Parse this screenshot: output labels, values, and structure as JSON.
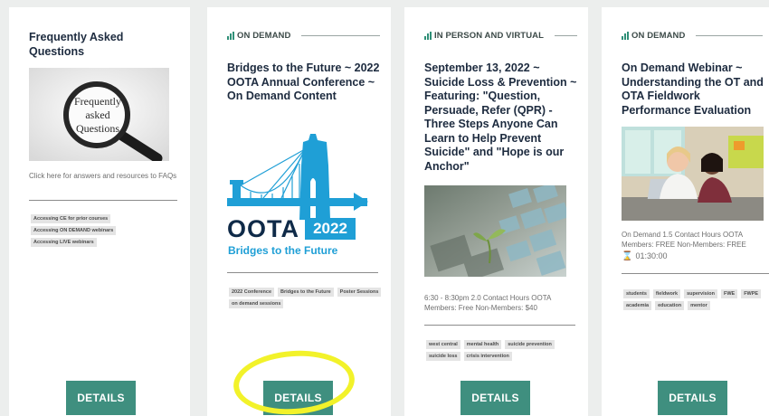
{
  "cards": [
    {
      "title": "Frequently Asked Questions",
      "image_text": "Frequently asked Questions",
      "meta": "Click here for answers and resources to FAQs",
      "tags": [
        "Accessing CE for prior courses",
        "Accessing ON DEMAND webinars",
        "Accessing LIVE webinars"
      ],
      "button": "DETAILS"
    },
    {
      "category": "ON DEMAND",
      "title": "Bridges to the Future ~ 2022 OOTA Annual Conference ~ On Demand Content",
      "logo": {
        "name": "OOTA",
        "year": "2022",
        "tagline": "Bridges to the Future"
      },
      "tags": [
        "2022 Conference",
        "Bridges to the Future",
        "Poster Sessions",
        "on demand sessions"
      ],
      "button": "DETAILS"
    },
    {
      "category": "IN PERSON AND VIRTUAL",
      "title": "September 13, 2022 ~ Suicide Loss & Prevention ~ Featuring: \"Question, Persuade, Refer (QPR) - Three Steps Anyone Can Learn to Help Prevent Suicide\" and \"Hope is our Anchor\"",
      "meta": "6:30 - 8:30pm 2.0 Contact Hours OOTA Members: Free Non-Members: $40",
      "tags": [
        "west central",
        "mental health",
        "suicide prevention",
        "suicide loss",
        "crisis intervention"
      ],
      "button": "DETAILS"
    },
    {
      "category": "ON DEMAND",
      "title": "On Demand Webinar ~ Understanding the OT and OTA Fieldwork Performance Evaluation",
      "meta": "On Demand 1.5 Contact Hours OOTA Members: FREE Non-Members: FREE",
      "duration": "01:30:00",
      "tags": [
        "students",
        "fieldwork",
        "supervision",
        "FWE",
        "FWPE",
        "academia",
        "education",
        "mentor"
      ],
      "button": "DETAILS"
    }
  ],
  "colors": {
    "accent": "#3f8f7f",
    "title": "#1d2b3f",
    "highlight": "#f2f22a",
    "logo_blue": "#1f9fd6"
  }
}
